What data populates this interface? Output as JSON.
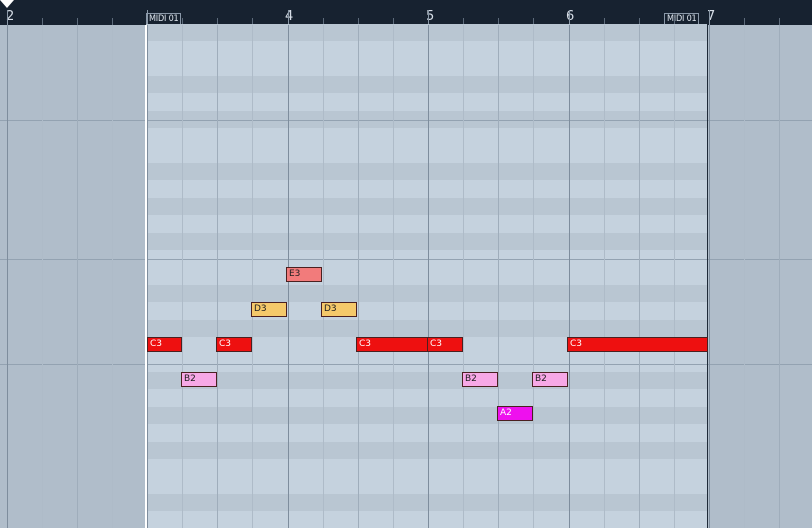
{
  "ruler": {
    "bars": [
      {
        "label": "2"
      },
      {
        "label": "4"
      },
      {
        "label": "5"
      },
      {
        "label": "6"
      },
      {
        "label": "7"
      }
    ],
    "part_labels": [
      {
        "text": "MIDI 01"
      },
      {
        "text": "MIDI 01"
      }
    ]
  },
  "notes": [
    {
      "pitch": "E3",
      "color": "#f27b7b",
      "text_color": "#202020"
    },
    {
      "pitch": "D3",
      "color": "#f5c96a",
      "text_color": "#202020"
    },
    {
      "pitch": "D3",
      "color": "#f5c96a",
      "text_color": "#202020"
    },
    {
      "pitch": "C3",
      "color": "#ee1010",
      "text_color": "#ffffff"
    },
    {
      "pitch": "C3",
      "color": "#ee1010",
      "text_color": "#ffffff"
    },
    {
      "pitch": "C3",
      "color": "#ee1010",
      "text_color": "#ffffff"
    },
    {
      "pitch": "C3",
      "color": "#ee1010",
      "text_color": "#ffffff"
    },
    {
      "pitch": "C3",
      "color": "#ee1010",
      "text_color": "#ffffff"
    },
    {
      "pitch": "B2",
      "color": "#f7a8e6",
      "text_color": "#202020"
    },
    {
      "pitch": "B2",
      "color": "#f7a8e6",
      "text_color": "#202020"
    },
    {
      "pitch": "B2",
      "color": "#f7a8e6",
      "text_color": "#202020"
    },
    {
      "pitch": "A2",
      "color": "#ee10ee",
      "text_color": "#ffffff"
    }
  ]
}
